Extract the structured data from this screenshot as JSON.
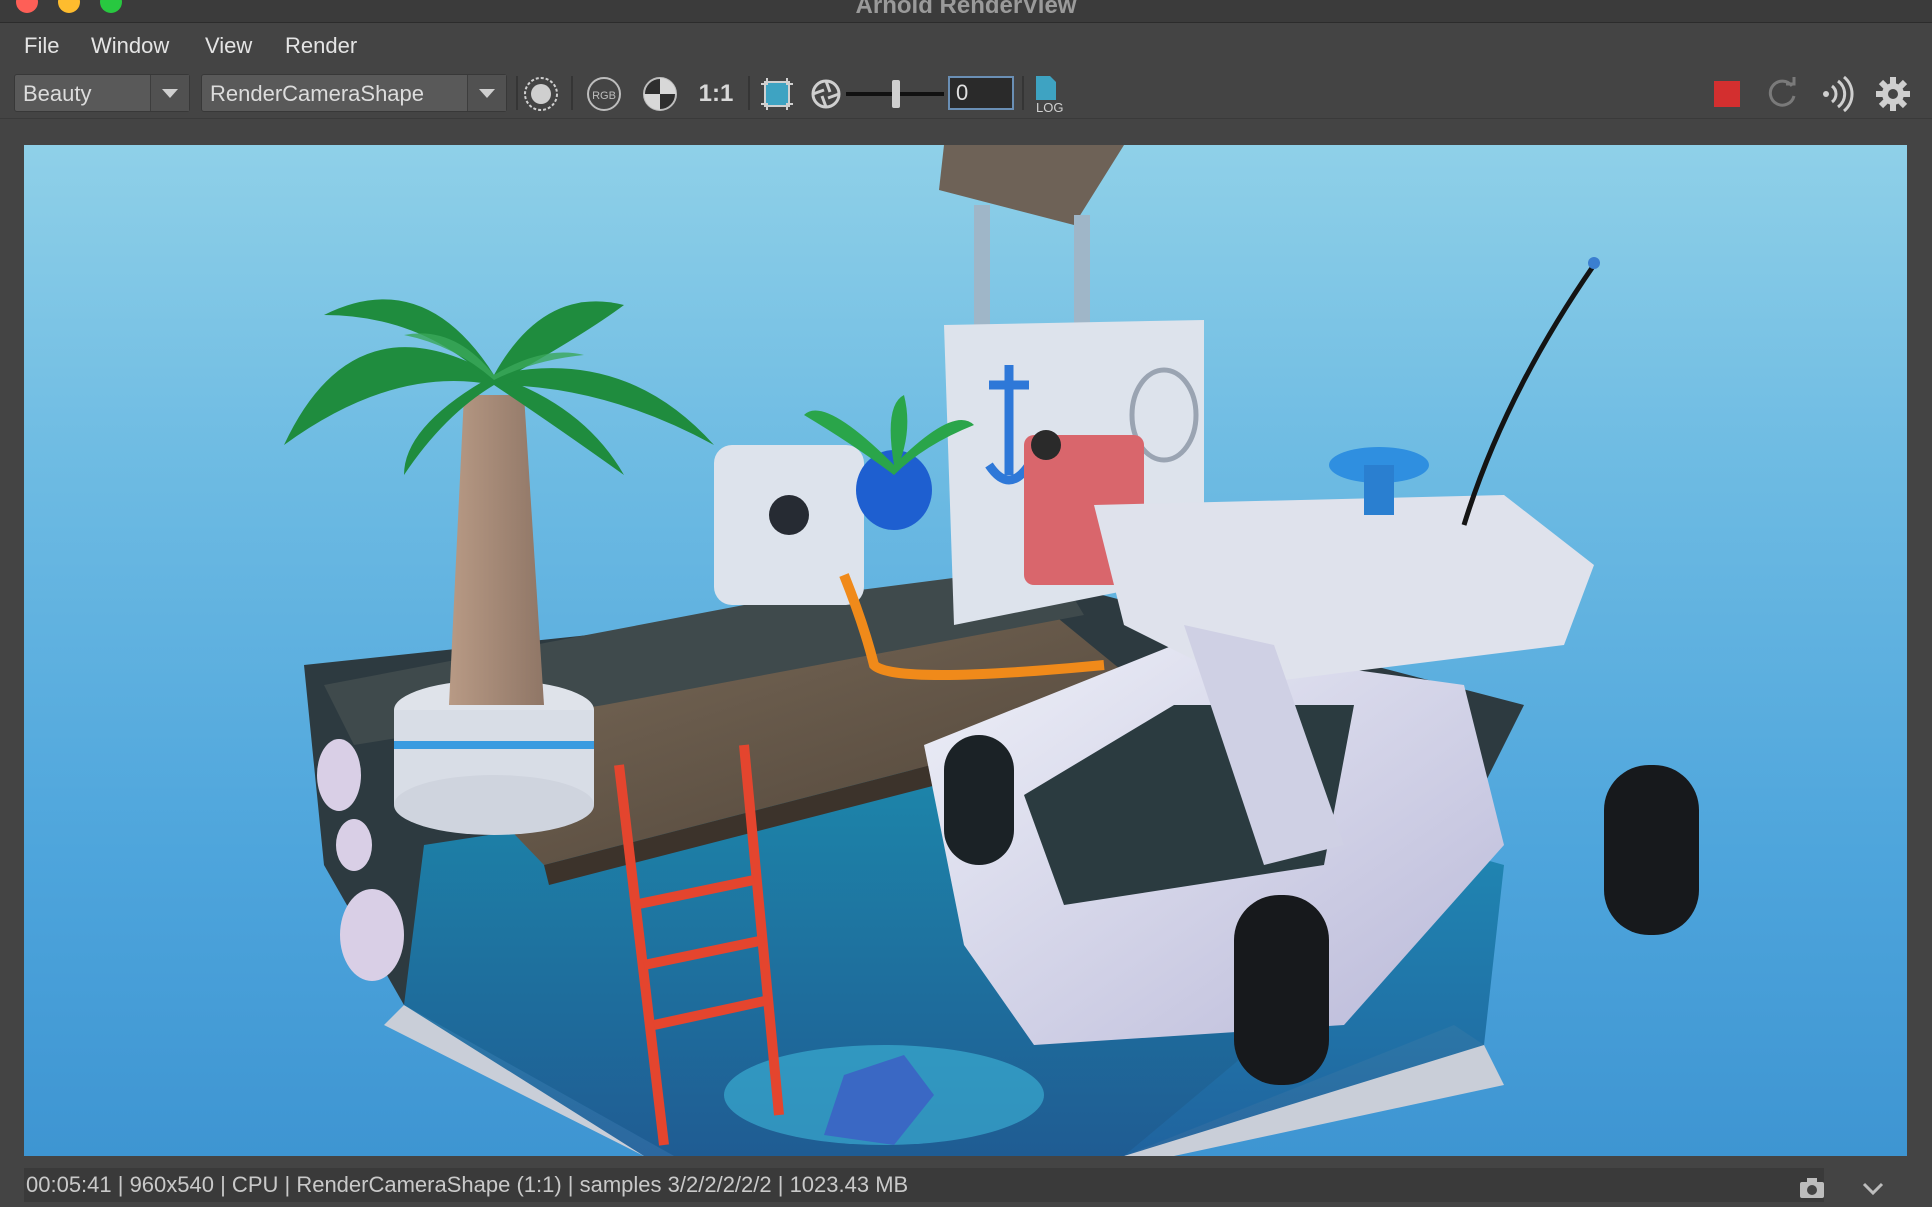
{
  "window": {
    "title": "Arnold RenderView"
  },
  "menu": {
    "items": [
      "File",
      "Window",
      "View",
      "Render"
    ]
  },
  "toolbar": {
    "aov_value": "Beauty",
    "camera_value": "RenderCameraShape",
    "ratio_label": "1:1",
    "exposure_value": "0",
    "log_label": "LOG"
  },
  "status": {
    "text": "00:05:41 | 960x540 | CPU | RenderCameraShape (1:1) | samples 3/2/2/2/2/2 | 1023.43 MB"
  },
  "colors": {
    "stop_red": "#d32f2f",
    "accent_blue": "#6a8fb5"
  },
  "icons": [
    "display-circle-icon",
    "rgb-channel-icon",
    "checker-alpha-icon",
    "crop-region-icon",
    "aperture-icon",
    "log-file-icon",
    "stop-icon",
    "refresh-icon",
    "broadcast-icon",
    "gear-icon",
    "snapshot-icon",
    "chevron-down-icon"
  ]
}
